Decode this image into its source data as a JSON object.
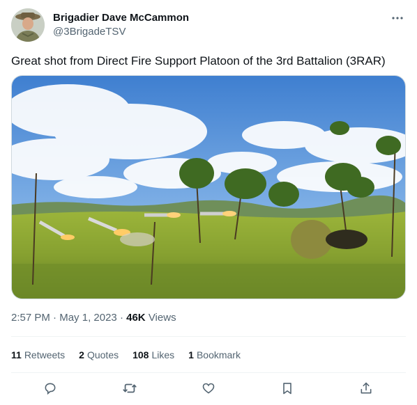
{
  "author": {
    "display_name": "Brigadier Dave McCammon",
    "handle": "@3BrigadeTSV"
  },
  "tweet": {
    "text": "Great shot from Direct Fire Support Platoon of the 3rd Battalion (3RAR)"
  },
  "meta": {
    "time": "2:57 PM",
    "separator": " · ",
    "date": "May 1, 2023",
    "views_count": "46K",
    "views_label": " Views"
  },
  "stats": {
    "retweets_count": "11",
    "retweets_label": "Retweets",
    "quotes_count": "2",
    "quotes_label": "Quotes",
    "likes_count": "108",
    "likes_label": "Likes",
    "bookmarks_count": "1",
    "bookmarks_label": "Bookmark"
  },
  "icons": {
    "more": "more-horizontal-icon",
    "reply": "reply-icon",
    "retweet": "retweet-icon",
    "like": "heart-icon",
    "bookmark": "bookmark-icon",
    "share": "share-icon"
  },
  "colors": {
    "text_primary": "#0f1419",
    "text_secondary": "#536471",
    "divider": "#eff3f4"
  }
}
